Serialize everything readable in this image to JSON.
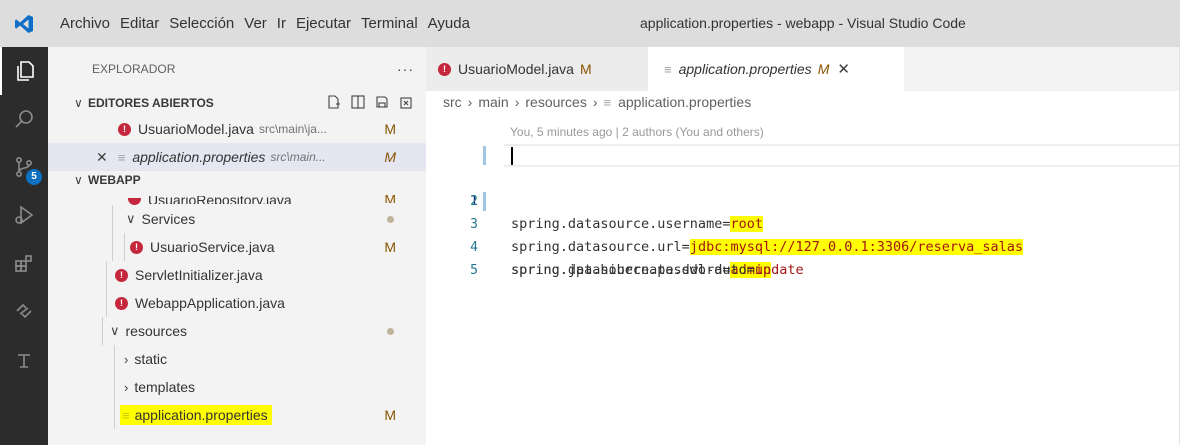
{
  "window": {
    "title": "application.properties - webapp - Visual Studio Code",
    "menu": [
      "Archivo",
      "Editar",
      "Selección",
      "Ver",
      "Ir",
      "Ejecutar",
      "Terminal",
      "Ayuda"
    ]
  },
  "activity_bar": {
    "icons": [
      "explorer-icon",
      "search-icon",
      "source-control-icon",
      "run-debug-icon",
      "extensions-icon",
      "remote-icon",
      "testing-icon"
    ],
    "source_control_badge": "5"
  },
  "sidebar": {
    "title": "EXPLORADOR",
    "more": "···",
    "open_editors": {
      "header": "EDITORES ABIERTOS",
      "items": [
        {
          "label": "UsuarioModel.java",
          "path": "src\\main\\ja...",
          "status": "M"
        },
        {
          "label": "application.properties",
          "path": "src\\main...",
          "status": "M"
        }
      ]
    },
    "workspace": {
      "header": "WEBAPP",
      "items": [
        {
          "label": "UsuarioRepository.java",
          "status": "M"
        },
        {
          "label": "Services"
        },
        {
          "label": "UsuarioService.java",
          "status": "M"
        },
        {
          "label": "ServletInitializer.java"
        },
        {
          "label": "WebappApplication.java"
        },
        {
          "label": "resources"
        },
        {
          "label": "static"
        },
        {
          "label": "templates"
        },
        {
          "label": "application.properties",
          "status": "M"
        }
      ]
    }
  },
  "editor": {
    "tabs": [
      {
        "label": "UsuarioModel.java",
        "status": "M"
      },
      {
        "label": "application.properties",
        "status": "M"
      }
    ],
    "breadcrumb": [
      "src",
      "main",
      "resources",
      "application.properties"
    ],
    "blame": "You, 5 minutes ago | 2 authors (You and others)",
    "lines": [
      {
        "number": "1",
        "key": "spring.datasource.url=",
        "value": "jdbc:mysql://127.0.0.1:3306/reserva_salas"
      },
      {
        "number": "2",
        "key": "spring.datasource.username=",
        "value": "root"
      },
      {
        "number": "3",
        "key": "spring.datasource.password=",
        "value": "admin"
      },
      {
        "number": "4",
        "key": "spring.jpa.hibernate.ddl-auto=",
        "value": "update"
      },
      {
        "number": "5",
        "key": "",
        "value": ""
      }
    ]
  },
  "colors": {
    "highlight": "#ffff00",
    "activity_bar": "#2c2c2c",
    "java_icon": "#c5283d",
    "modified": "#895503"
  }
}
